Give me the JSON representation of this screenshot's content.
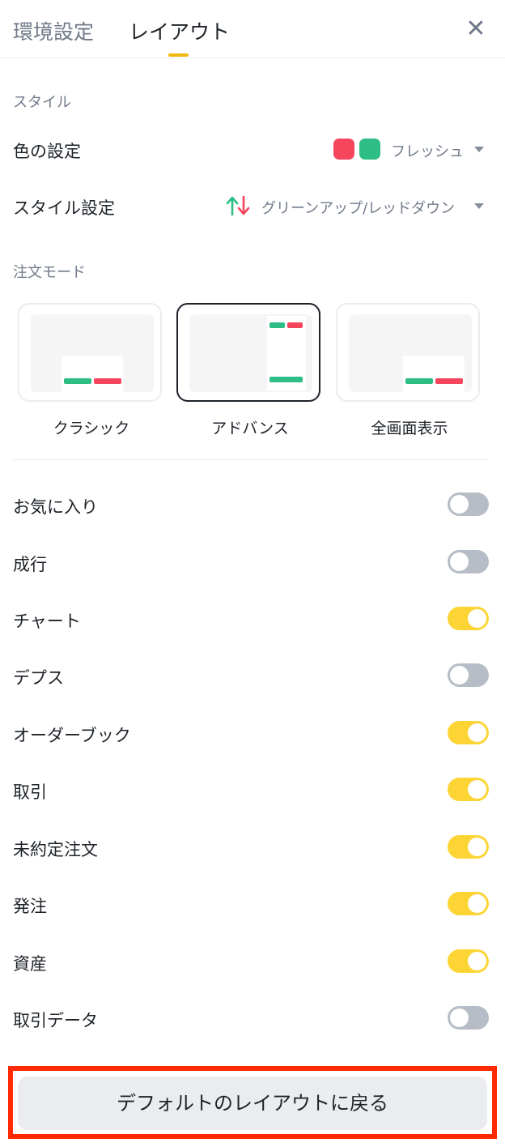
{
  "header": {
    "tabs": [
      {
        "label": "環境設定",
        "active": false
      },
      {
        "label": "レイアウト",
        "active": true
      }
    ],
    "close_icon": "close-icon",
    "accent_color": "#f0b90b"
  },
  "style_section": {
    "title": "スタイル",
    "color_setting": {
      "label": "色の設定",
      "swatches": [
        "#f6465d",
        "#2ebd85"
      ],
      "value": "フレッシュ"
    },
    "style_setting": {
      "label": "スタイル設定",
      "icon": "up-down-arrows-icon",
      "value": "グリーンアップ/レッドダウン"
    }
  },
  "order_mode": {
    "title": "注文モード",
    "modes": [
      {
        "label": "クラシック",
        "selected": false
      },
      {
        "label": "アドバンス",
        "selected": true
      },
      {
        "label": "全画面表示",
        "selected": false
      }
    ]
  },
  "toggles": [
    {
      "label": "お気に入り",
      "on": false
    },
    {
      "label": "成行",
      "on": false
    },
    {
      "label": "チャート",
      "on": true
    },
    {
      "label": "デプス",
      "on": false
    },
    {
      "label": "オーダーブック",
      "on": true
    },
    {
      "label": "取引",
      "on": true
    },
    {
      "label": "未約定注文",
      "on": true
    },
    {
      "label": "発注",
      "on": true
    },
    {
      "label": "資産",
      "on": true
    },
    {
      "label": "取引データ",
      "on": false
    }
  ],
  "reset_button": {
    "label": "デフォルトのレイアウトに戻る",
    "highlight_color": "#ff2a00"
  }
}
